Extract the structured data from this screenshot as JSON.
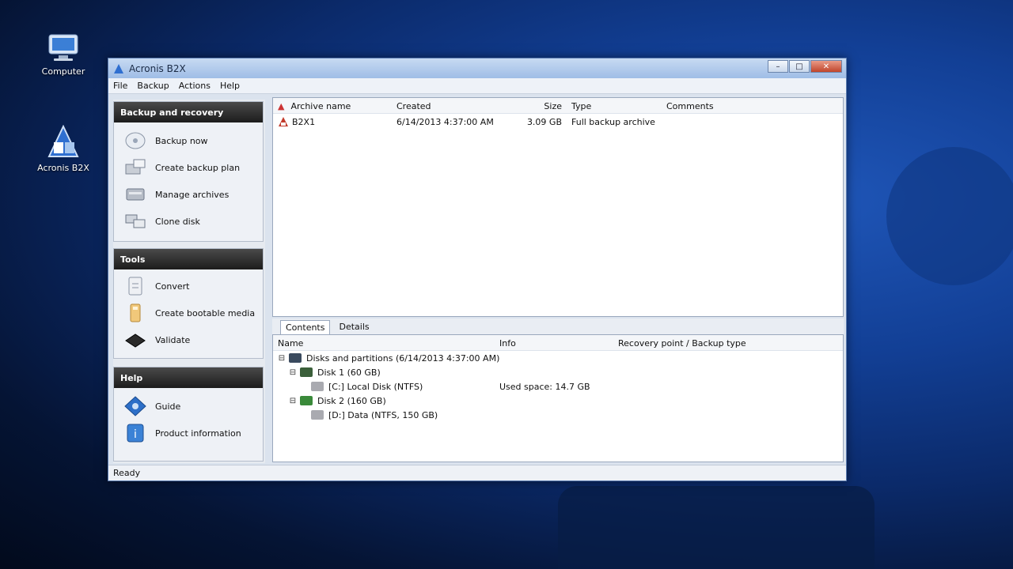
{
  "desktop": {
    "icons": [
      {
        "label": "Computer",
        "icon": "computer-icon"
      },
      {
        "label": "Acronis B2X",
        "icon": "acronis-app-icon"
      }
    ]
  },
  "window": {
    "title": "Acronis B2X",
    "controls": {
      "minimize": "–",
      "maximize": "□",
      "close": "✕"
    },
    "menu": [
      "File",
      "Backup",
      "Actions",
      "Help"
    ]
  },
  "left_panel": {
    "groups": [
      {
        "header": "Backup and recovery",
        "items": [
          {
            "label": "Backup now",
            "icon": "disk-backup-icon"
          },
          {
            "label": "Create backup plan",
            "icon": "backup-plan-icon"
          },
          {
            "label": "Manage archives",
            "icon": "archives-icon"
          },
          {
            "label": "Clone disk",
            "icon": "clone-disk-icon"
          }
        ]
      },
      {
        "header": "Tools",
        "items": [
          {
            "label": "Convert",
            "icon": "convert-icon"
          },
          {
            "label": "Create bootable media",
            "icon": "bootable-media-icon"
          },
          {
            "label": "Validate",
            "icon": "validate-icon"
          }
        ]
      },
      {
        "header": "Help",
        "items": [
          {
            "label": "Guide",
            "icon": "guide-icon"
          },
          {
            "label": "Product information",
            "icon": "info-icon"
          }
        ]
      }
    ]
  },
  "file_list": {
    "columns": [
      "Archive name",
      "Created",
      "Size",
      "Type",
      "Comments"
    ],
    "rows": [
      {
        "name": "B2X1",
        "created": "6/14/2013 4:37:00 AM",
        "size": "3.09 GB",
        "type": "Full backup archive",
        "comments": ""
      }
    ]
  },
  "tabs": [
    "Contents",
    "Details"
  ],
  "tree": {
    "columns": [
      "Name",
      "Info",
      "Recovery point / Backup type"
    ],
    "rows": [
      {
        "level": 0,
        "toggle": "⊟",
        "label": "Disks and partitions (6/14/2013 4:37:00 AM)",
        "info": "",
        "icon_color": "#3a4a5e"
      },
      {
        "level": 1,
        "toggle": "⊟",
        "label": "Disk 1 (60 GB)",
        "info": "",
        "icon_color": "#3b5f3a"
      },
      {
        "level": 2,
        "toggle": "",
        "label": "[C:] Local Disk (NTFS)",
        "info": "Used space: 14.7 GB",
        "icon_color": "#a9aab0"
      },
      {
        "level": 1,
        "toggle": "⊟",
        "label": "Disk 2 (160 GB)",
        "info": "",
        "icon_color": "#3a8a3a"
      },
      {
        "level": 2,
        "toggle": "",
        "label": "[D:] Data (NTFS, 150 GB)",
        "info": "",
        "icon_color": "#a9aab0"
      }
    ]
  },
  "status": "Ready"
}
